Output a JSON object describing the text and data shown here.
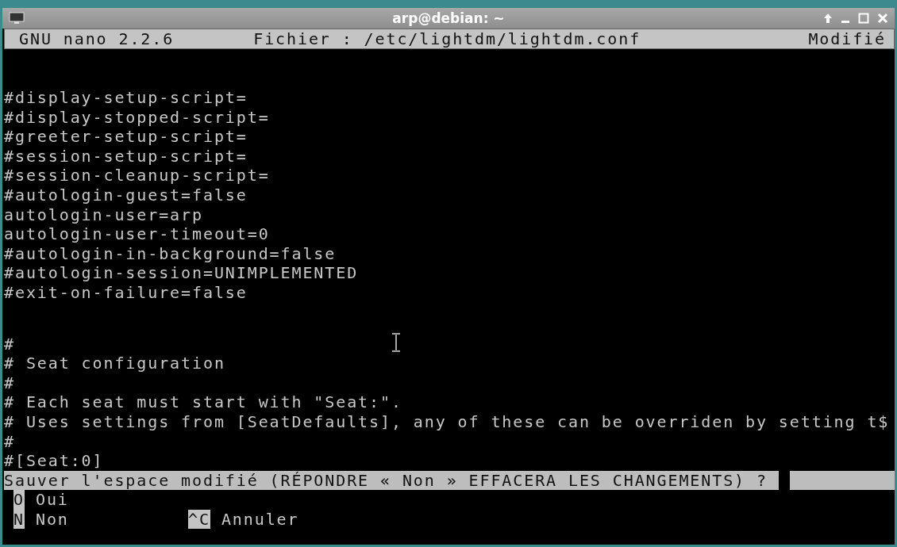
{
  "window": {
    "title": "arp@debian: ~"
  },
  "header": {
    "app": "GNU nano 2.2.6",
    "file": "Fichier : /etc/lightdm/lightdm.conf",
    "status": "Modifié"
  },
  "sections": [
    {
      "lines": [
        "#display-setup-script=",
        "#display-stopped-script=",
        "#greeter-setup-script=",
        "#session-setup-script=",
        "#session-cleanup-script=",
        "#autologin-guest=false",
        "autologin-user=arp",
        "autologin-user-timeout=0",
        "#autologin-in-background=false",
        "#autologin-session=UNIMPLEMENTED",
        "#exit-on-failure=false"
      ]
    },
    {
      "lines": [
        "#",
        "# Seat configuration",
        "#",
        "# Each seat must start with \"Seat:\".",
        "# Uses settings from [SeatDefaults], any of these can be overriden by setting t$",
        "#",
        "#[Seat:0]"
      ]
    }
  ],
  "prompt": {
    "question": "Sauver l'espace modifié (RÉPONDRE « Non » EFFACERA LES CHANGEMENTS) ?"
  },
  "option_rows": [
    [
      {
        "key": "O",
        "label": "Oui"
      }
    ],
    [
      {
        "key": "N",
        "label": "Non"
      },
      {
        "key": "^C",
        "label": "Annuler"
      }
    ]
  ]
}
